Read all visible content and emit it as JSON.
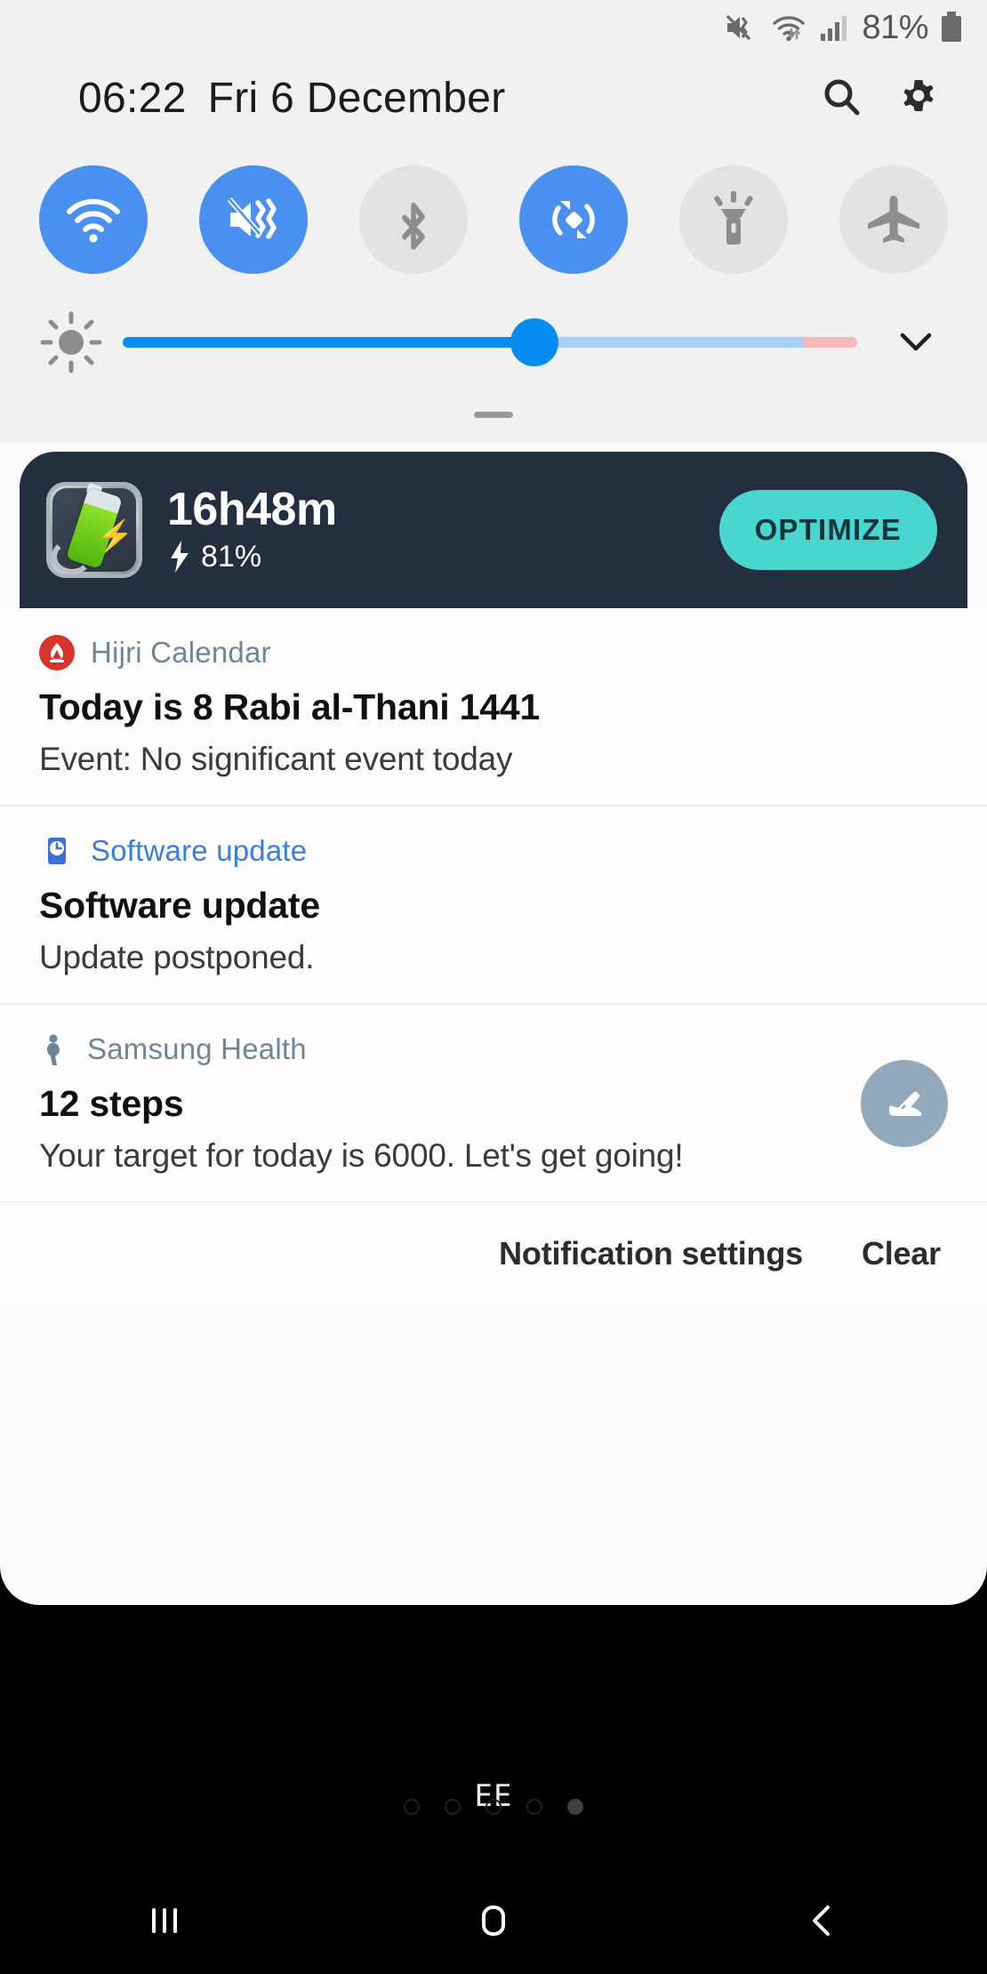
{
  "status_bar": {
    "icons": [
      "mute-vibrate-icon",
      "wifi-icon",
      "signal-bars-icon"
    ],
    "battery_percent": "81%",
    "battery_icon": "battery-full-icon"
  },
  "quick_settings": {
    "time": "06:22",
    "date": "Fri 6 December",
    "search_icon": "search-icon",
    "settings_icon": "gear-icon",
    "expand_icon": "chevron-down-icon",
    "drag_handle": "drag-handle",
    "toggles": [
      {
        "name": "wifi",
        "icon": "wifi-icon",
        "state": "on"
      },
      {
        "name": "sound-mode",
        "icon": "mute-vibrate-icon",
        "state": "on"
      },
      {
        "name": "bluetooth",
        "icon": "bluetooth-icon",
        "state": "off"
      },
      {
        "name": "auto-rotate",
        "icon": "auto-rotate-icon",
        "state": "on"
      },
      {
        "name": "flashlight",
        "icon": "flashlight-icon",
        "state": "off"
      },
      {
        "name": "airplane-mode",
        "icon": "airplane-icon",
        "state": "off"
      }
    ],
    "brightness": {
      "icon": "brightness-sun-icon",
      "value_percent": 56,
      "warning_zone_percent": 7.5
    }
  },
  "battery_card": {
    "app_icon": "battery-optimizer-icon",
    "time_remaining": "16h48m",
    "charge_icon": "lightning-bolt-icon",
    "charge_percent": "81%",
    "button_label": "OPTIMIZE",
    "accent_color": "#49d6d0",
    "background_color": "#232f3e"
  },
  "notifications": [
    {
      "app": "Hijri Calendar",
      "app_icon": "mosque-dome-icon",
      "app_color": "#6f8697",
      "icon_bg": "#d9332c",
      "title": "Today is 8 Rabi al-Thani 1441",
      "body": "Event: No significant event today",
      "right_icon": null
    },
    {
      "app": "Software update",
      "app_icon": "phone-clock-icon",
      "app_color": "#3b7ddd",
      "icon_bg": "#3b6fe0",
      "title": "Software update",
      "body": "Update postponed.",
      "right_icon": null
    },
    {
      "app": "Samsung Health",
      "app_icon": "walking-person-icon",
      "app_color": "#6f8697",
      "icon_bg": "transparent",
      "title": "12 steps",
      "body": "Your target for today is 6000. Let's get going!",
      "right_icon": "running-shoe-icon"
    }
  ],
  "notification_footer": {
    "settings_label": "Notification settings",
    "clear_label": "Clear"
  },
  "home_screen": {
    "carrier_label": "EE",
    "page_dots": [
      {
        "active": false
      },
      {
        "active": false
      },
      {
        "active": false
      },
      {
        "active": false
      },
      {
        "active": true
      }
    ]
  },
  "nav_bar": {
    "recents_icon": "recents-icon",
    "home_icon": "home-icon",
    "back_icon": "back-icon"
  }
}
